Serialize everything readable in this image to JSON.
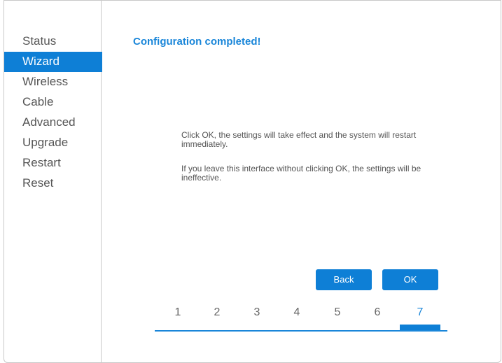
{
  "sidebar": {
    "items": [
      {
        "label": "Status"
      },
      {
        "label": "Wizard"
      },
      {
        "label": "Wireless"
      },
      {
        "label": "Cable"
      },
      {
        "label": "Advanced"
      },
      {
        "label": "Upgrade"
      },
      {
        "label": "Restart"
      },
      {
        "label": "Reset"
      }
    ],
    "active": "Wizard"
  },
  "main": {
    "title": "Configuration completed!",
    "message1": "Click OK, the settings will take effect and the system will restart immediately.",
    "message2": "If you leave this interface without clicking OK, the settings will be ineffective.",
    "back_label": "Back",
    "ok_label": "OK"
  },
  "wizard_steps": {
    "steps": [
      "1",
      "2",
      "3",
      "4",
      "5",
      "6",
      "7"
    ],
    "current": "7"
  },
  "colors": {
    "accent": "#0e7fd6",
    "title": "#1a86d9",
    "text": "#555555"
  }
}
